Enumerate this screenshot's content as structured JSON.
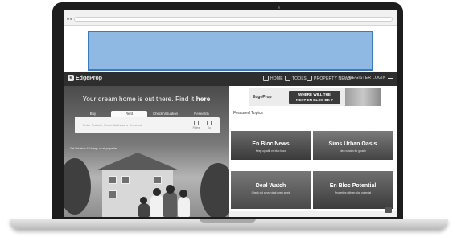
{
  "nav": {
    "brand": "EdgeProp",
    "items": [
      {
        "label": "HOME",
        "icon": "home-icon"
      },
      {
        "label": "TOOLS",
        "icon": "tools-icon"
      },
      {
        "label": "PROPERTY NEWS",
        "icon": "news-icon"
      },
      {
        "label": "REGISTER"
      },
      {
        "label": "LOGIN"
      }
    ],
    "menu_icon": "hamburger-menu-icon"
  },
  "hero": {
    "title": "Your dream home is out there. Find it",
    "title_emphasis": "here",
    "tabs": [
      "Buy",
      "Rent",
      "Check Valuation",
      "Research"
    ],
    "active_tab": "Rent",
    "search_placeholder": "Enter Suburb, Street Address or Keyword",
    "filter_labels": [
      "Filters",
      "Go"
    ],
    "note": "Get Valuation & Listings on all properties"
  },
  "promo": {
    "brand": "EdgeProp",
    "headline_line1": "WHERE WILL THE",
    "headline_line2": "NEXT EN BLOC BE ?"
  },
  "featured": {
    "label": "Featured Topics",
    "topics": [
      {
        "title": "En Bloc News",
        "subtitle": "Keep up with en bloc buzz"
      },
      {
        "title": "Sims Urban Oasis",
        "subtitle": "New condos for growth"
      },
      {
        "title": "Deal Watch",
        "subtitle": "Check out a new deal every week"
      },
      {
        "title": "En Bloc Potential",
        "subtitle": "Properties with en bloc potential"
      }
    ]
  },
  "colors": {
    "ad_fill": "#8fb8e2",
    "ad_border": "#3d7bb8",
    "nav_bg": "#2e2e2e"
  }
}
